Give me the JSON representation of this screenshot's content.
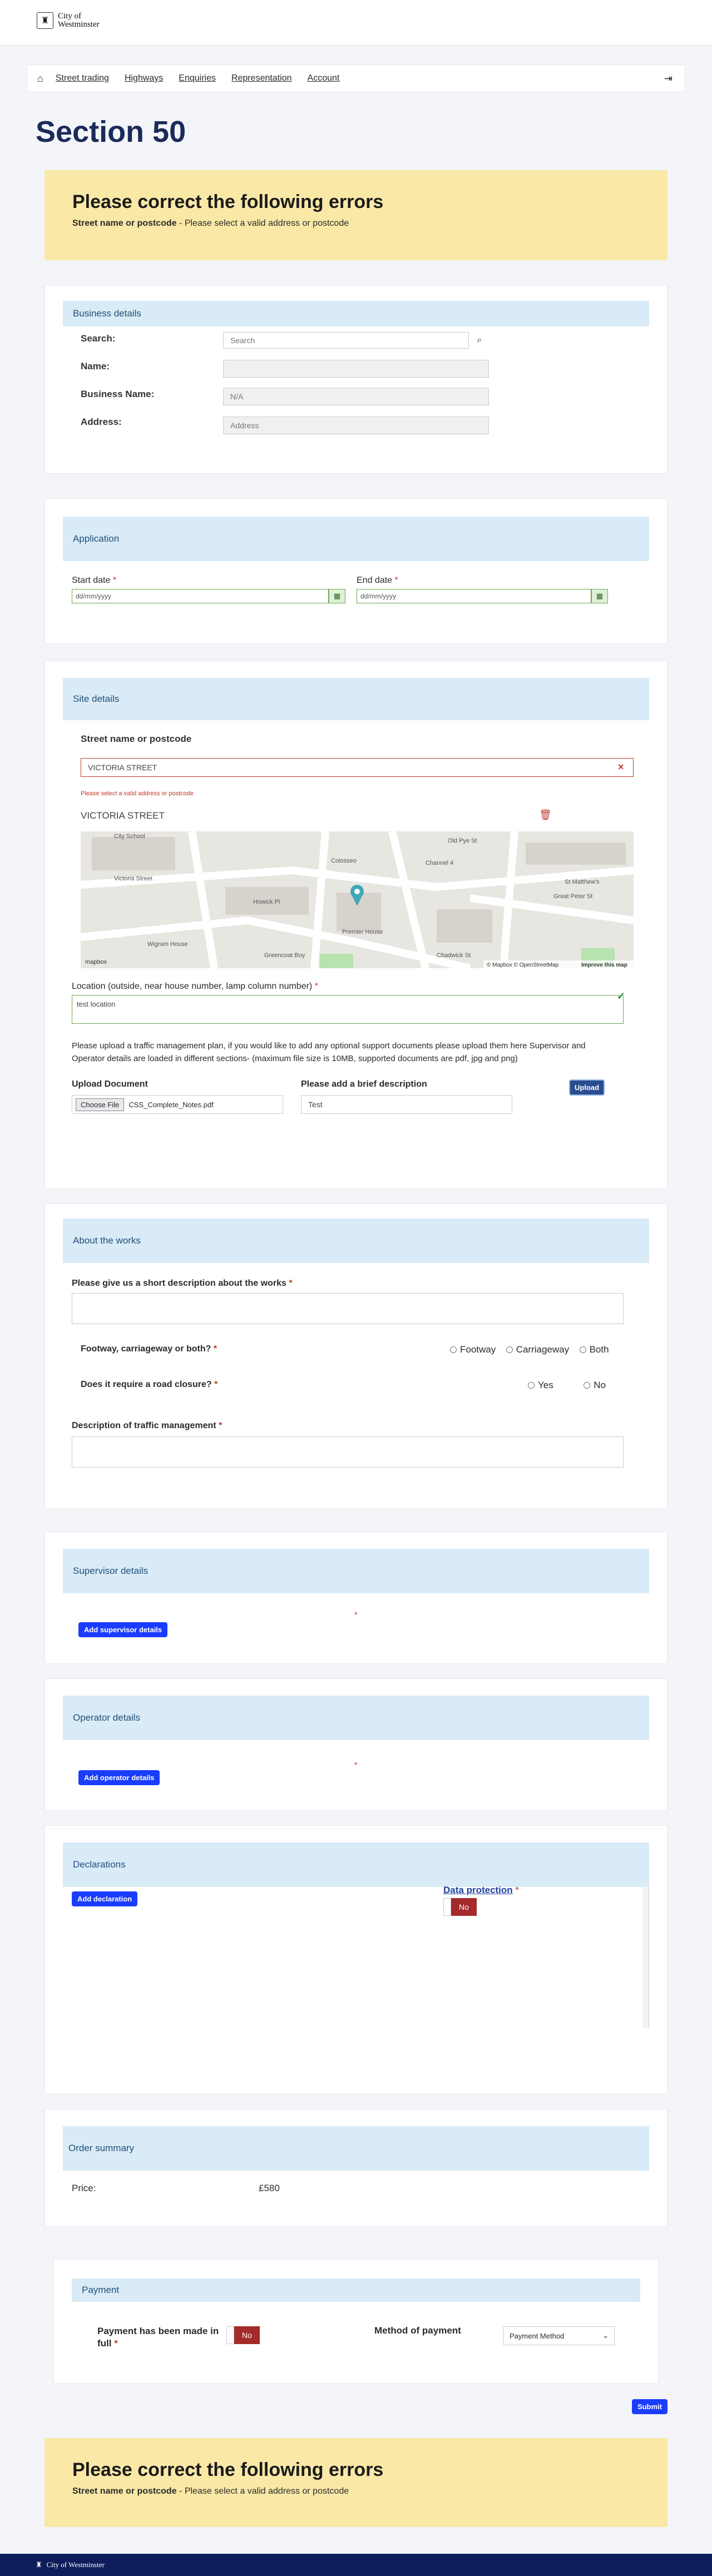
{
  "header": {
    "logo_line1": "City of",
    "logo_line2": "Westminster",
    "crest_icon": "crest-icon"
  },
  "nav": {
    "home_icon": "home-icon",
    "items": [
      "Street trading",
      "Highways",
      "Enquiries",
      "Representation",
      "Account"
    ],
    "logout_icon": "logout-icon"
  },
  "page_title": "Section 50",
  "errors": {
    "title": "Please correct the following errors",
    "field": "Street name or postcode",
    "message": " - Please select a valid address or postcode"
  },
  "business": {
    "heading": "Business details",
    "search_label": "Search:",
    "search_placeholder": "Search",
    "name_label": "Name:",
    "name_value": "",
    "business_name_label": "Business Name:",
    "business_name_value": "N/A",
    "address_label": "Address:",
    "address_placeholder": "Address"
  },
  "application": {
    "heading": "Application",
    "start_label": "Start date",
    "start_value": "dd/mm/yyyy",
    "end_label": "End date",
    "end_value": "dd/mm/yyyy"
  },
  "site": {
    "heading": "Site details",
    "street_label": "Street name or postcode",
    "street_value": "VICTORIA STREET",
    "street_error": "Please select a valid address or postcode",
    "selected_street": "VICTORIA STREET",
    "map_labels": [
      "City School",
      "Old Pye St",
      "Victoria Street",
      "Howick Pl",
      "Wigram House",
      "Premier House",
      "Greencoat Boy",
      "Colosseo",
      "Channel 4",
      "Great Peter St",
      "Chadwick St",
      "St Matthew's"
    ],
    "map_attribution": "© Mapbox © OpenStreetMap",
    "map_improve": "Improve this map",
    "mapbox_logo": "mapbox",
    "location_label": "Location (outside, near house number, lamp column number)",
    "location_value": "test location",
    "upload_intro": "Please upload a traffic management plan, if you would like to add any optional support documents please upload them here Supervisor and Operator details are loaded in different sections- (maximum file size is 10MB, supported documents are pdf, jpg and png)",
    "upload_label": "Upload Document",
    "choose_file": "Choose File",
    "file_name": "CSS_Complete_Notes.pdf",
    "desc_label": "Please add a brief description",
    "desc_value": "Test",
    "upload_button": "Upload"
  },
  "works": {
    "heading": "About the works",
    "short_desc_label": "Please give us a short description about the works",
    "footway_label": "Footway, carriageway or both?",
    "footway_options": [
      "Footway",
      "Carriageway",
      "Both"
    ],
    "closure_label": "Does it require a road closure?",
    "closure_options": [
      "Yes",
      "No"
    ],
    "traffic_label": "Description of traffic management"
  },
  "supervisor": {
    "heading": "Supervisor details",
    "button": "Add supervisor details"
  },
  "operator": {
    "heading": "Operator details",
    "button": "Add operator details"
  },
  "declarations": {
    "heading": "Declarations",
    "button": "Add declaration",
    "data_protection": "Data protection",
    "toggle": "No"
  },
  "order": {
    "heading": "Order summary",
    "price_label": "Price:",
    "price_value": "£580"
  },
  "payment": {
    "heading": "Payment",
    "made_label": "Payment has been made in full",
    "made_toggle": "No",
    "method_label": "Method of payment",
    "method_value": "Payment Method"
  },
  "submit": "Submit",
  "footer": {
    "text": "City of Westminster"
  }
}
